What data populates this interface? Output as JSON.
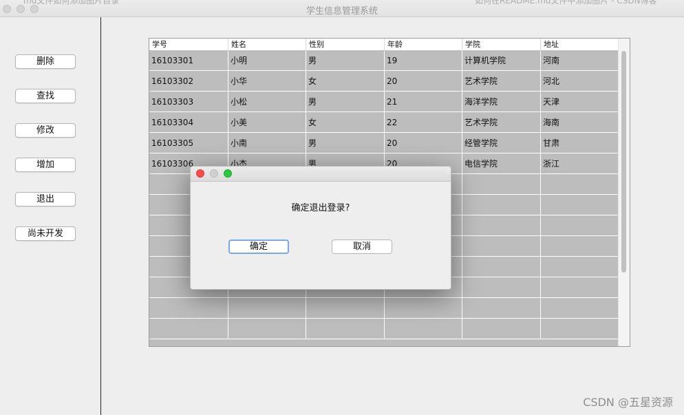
{
  "window": {
    "title": "学生信息管理系统",
    "ghost_left": "md文件如何添加图片目录",
    "ghost_right": "如何在README.md文件中添加图片 - CSDN博客"
  },
  "sidebar": {
    "buttons": [
      {
        "label": "删除"
      },
      {
        "label": "查找"
      },
      {
        "label": "修改"
      },
      {
        "label": "增加"
      },
      {
        "label": "退出"
      },
      {
        "label": "尚未开发"
      }
    ]
  },
  "table": {
    "columns": [
      "学号",
      "姓名",
      "性别",
      "年龄",
      "学院",
      "地址"
    ],
    "rows": [
      [
        "16103301",
        "小明",
        "男",
        "19",
        "计算机学院",
        "河南"
      ],
      [
        "16103302",
        "小华",
        "女",
        "20",
        "艺术学院",
        "河北"
      ],
      [
        "16103303",
        "小松",
        "男",
        "21",
        "海洋学院",
        "天津"
      ],
      [
        "16103304",
        "小美",
        "女",
        "22",
        "艺术学院",
        "海南"
      ],
      [
        "16103305",
        "小南",
        "男",
        "20",
        "经管学院",
        "甘肃"
      ],
      [
        "16103306",
        "小杰",
        "男",
        "20",
        "电信学院",
        "浙江"
      ]
    ],
    "empty_rows": 8
  },
  "dialog": {
    "message": "确定退出登录?",
    "confirm_label": "确定",
    "cancel_label": "取消",
    "colors": {
      "close": "#fc4b4b",
      "minimize": "#d0d0d0",
      "zoom": "#2ac83f"
    }
  },
  "watermark": "CSDN @五星资源"
}
